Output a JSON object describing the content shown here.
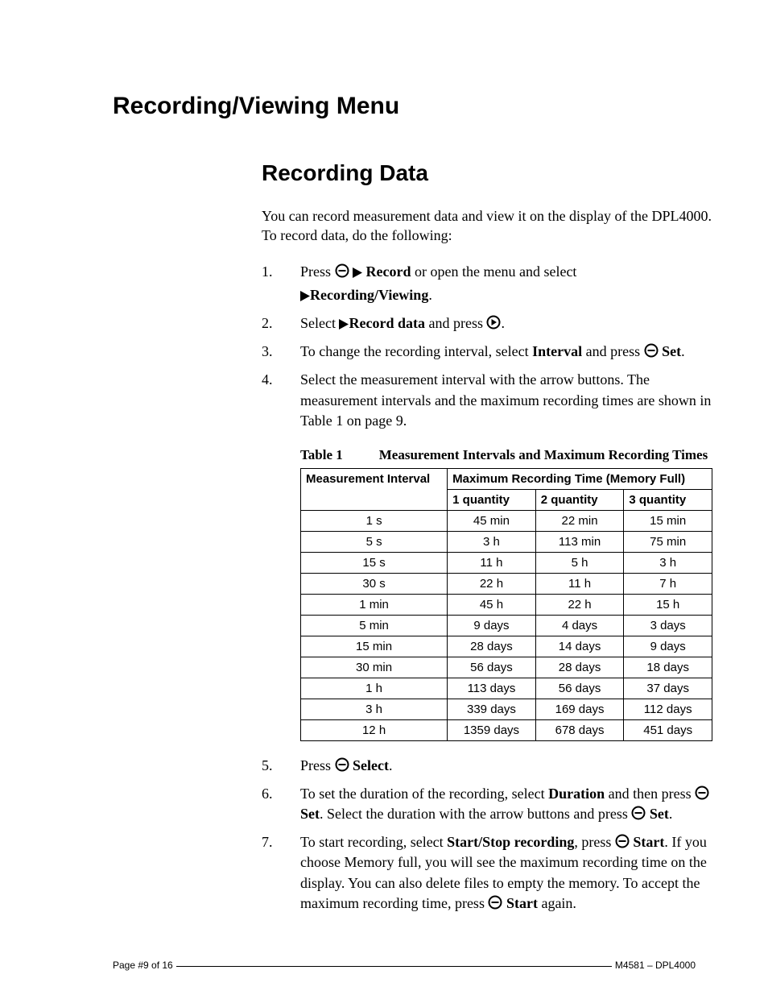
{
  "titles": {
    "h1": "Recording/Viewing Menu",
    "h2": "Recording Data"
  },
  "intro": "You can record measurement data and view it on the display of the DPL4000.  To record data, do the following:",
  "steps": {
    "s1": {
      "num": "1.",
      "a": "Press ",
      "b": " Record",
      "c": " or open the menu and select ",
      "d": "Recording/Viewing",
      "e": "."
    },
    "s2": {
      "num": "2.",
      "a": "Select ",
      "b": "Record data",
      "c": " and press ",
      "d": "."
    },
    "s3": {
      "num": "3.",
      "a": "To change the recording interval, select ",
      "b": "Interval",
      "c": " and press ",
      "d": " Set",
      "e": "."
    },
    "s4": {
      "num": "4.",
      "a": "Select the measurement interval with the arrow buttons. The measurement intervals and the maximum recording times are shown in Table 1 on page 9."
    },
    "s5": {
      "num": "5.",
      "a": "Press ",
      "b": " Select",
      "c": "."
    },
    "s6": {
      "num": "6.",
      "a": "To set the duration of the recording, select ",
      "b": "Duration",
      "c": " and then press ",
      "d": " Set",
      "e": ". Select the duration with the arrow buttons and press ",
      "f": " Set",
      "g": "."
    },
    "s7": {
      "num": "7.",
      "a": "To start recording, select ",
      "b": "Start/Stop recording",
      "c": ", press ",
      "d": " Start",
      "e": ". If you choose Memory full, you will see the maximum recording time on the display. You can also delete files to empty the memory. To accept the maximum recording time, press ",
      "f": " Start",
      "g": " again."
    }
  },
  "chart_data": {
    "type": "table",
    "caption_num": "Table 1",
    "caption_text": "Measurement Intervals and Maximum Recording Times",
    "head": {
      "r0c0": "Measurement Interval",
      "r0c1": "Maximum Recording Time (Memory Full)",
      "r1c1": "1 quantity",
      "r1c2": "2 quantity",
      "r1c3": "3 quantity"
    },
    "rows": [
      {
        "i": "1 s",
        "q1": "45 min",
        "q2": "22 min",
        "q3": "15 min"
      },
      {
        "i": "5 s",
        "q1": "3 h",
        "q2": "113 min",
        "q3": "75 min"
      },
      {
        "i": "15 s",
        "q1": "11 h",
        "q2": "5 h",
        "q3": "3 h"
      },
      {
        "i": "30 s",
        "q1": "22 h",
        "q2": "11 h",
        "q3": "7 h"
      },
      {
        "i": "1 min",
        "q1": "45 h",
        "q2": "22 h",
        "q3": "15 h"
      },
      {
        "i": "5 min",
        "q1": "9 days",
        "q2": "4 days",
        "q3": "3 days"
      },
      {
        "i": "15 min",
        "q1": "28 days",
        "q2": "14 days",
        "q3": "9 days"
      },
      {
        "i": "30 min",
        "q1": "56 days",
        "q2": "28 days",
        "q3": "18 days"
      },
      {
        "i": "1 h",
        "q1": "113 days",
        "q2": "56 days",
        "q3": "37 days"
      },
      {
        "i": "3 h",
        "q1": "339 days",
        "q2": "169 days",
        "q3": "112 days"
      },
      {
        "i": "12 h",
        "q1": "1359 days",
        "q2": "678 days",
        "q3": "451 days"
      }
    ]
  },
  "footer": {
    "page": "Page #9 of 16",
    "doc": "M4581 – DPL4000"
  }
}
